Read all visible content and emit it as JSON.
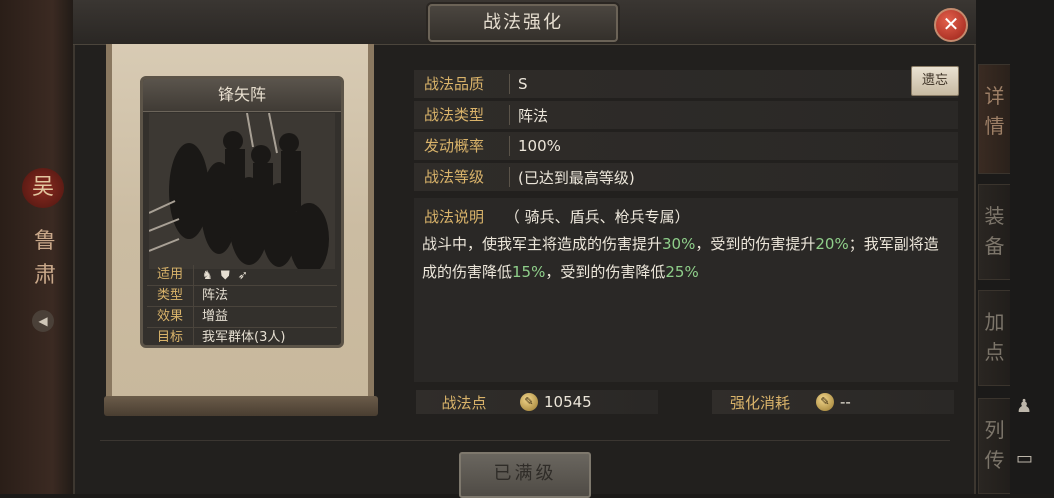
{
  "window": {
    "title": "战法强化"
  },
  "background": {
    "general_faction": "吴",
    "general_name": "鲁肃",
    "side_tabs": [
      {
        "label": "详情",
        "active": true
      },
      {
        "label": "装备",
        "active": false
      },
      {
        "label": "加点",
        "active": false
      },
      {
        "label": "列传",
        "active": false
      }
    ]
  },
  "card": {
    "name": "锋矢阵",
    "rows": [
      {
        "key": "适用",
        "icons": [
          "cavalry-icon",
          "shield-icon",
          "spear-icon"
        ]
      },
      {
        "key": "类型",
        "value": "阵法"
      },
      {
        "key": "效果",
        "value": "增益"
      },
      {
        "key": "目标",
        "value": "我军群体(3人)"
      }
    ]
  },
  "info": {
    "quality_label": "战法品质",
    "quality_value": "S",
    "type_label": "战法类型",
    "type_value": "阵法",
    "chance_label": "发动概率",
    "chance_value": "100%",
    "level_label": "战法等级",
    "level_value": "(已达到最高等级)",
    "forget_button": "遗忘"
  },
  "description": {
    "label": "战法说明",
    "restriction": "（ 骑兵、盾兵、枪兵专属）",
    "text_parts": [
      {
        "t": "战斗中，使我军主将造成的伤害提升",
        "hl": false
      },
      {
        "t": "30%",
        "hl": true
      },
      {
        "t": "，受到的伤害提升",
        "hl": false
      },
      {
        "t": "20%",
        "hl": true
      },
      {
        "t": "；我军副将造成的伤害降低",
        "hl": false
      },
      {
        "t": "15%",
        "hl": true
      },
      {
        "t": "，受到的伤害降低",
        "hl": false
      },
      {
        "t": "25%",
        "hl": true
      }
    ]
  },
  "footer": {
    "points_label": "战法点",
    "points_value": "10545",
    "cost_label": "强化消耗",
    "cost_value": "--",
    "maxed_button": "已满级"
  },
  "colors": {
    "accent_gold": "#d9b36a",
    "highlight_green": "#8fcf8a",
    "close_red": "#c0392b"
  }
}
